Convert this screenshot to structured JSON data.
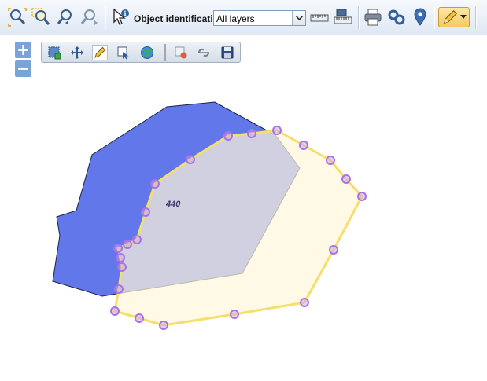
{
  "toolbar": {
    "buttons": [
      {
        "name": "zoom-extent-icon"
      },
      {
        "name": "zoom-selection-icon"
      },
      {
        "name": "zoom-previous-icon"
      },
      {
        "name": "zoom-next-icon"
      },
      {
        "name": "identify-icon"
      },
      {
        "name": "measure-distance-icon"
      },
      {
        "name": "measure-area-icon"
      },
      {
        "name": "print-icon"
      },
      {
        "name": "link-icon"
      },
      {
        "name": "marker-icon"
      },
      {
        "name": "edit-pencil-icon"
      }
    ],
    "object_identification_label": "Object identification:",
    "layer_select_value": "All layers"
  },
  "zoom_controls": {
    "in": "+",
    "out": "−"
  },
  "edit_toolbar": {
    "tools": [
      "select-area-icon",
      "move-icon",
      "draw-pencil-icon",
      "select-feature-icon",
      "globe-icon",
      "delete-icon",
      "split-icon",
      "save-icon"
    ]
  },
  "map": {
    "feature_label": "440",
    "colors": {
      "blue_polygon": "#6177ea",
      "edit_polygon_fill": "#fff6dc",
      "edit_polygon_stroke": "#f5df6a",
      "vertex": "#a971e6"
    }
  }
}
